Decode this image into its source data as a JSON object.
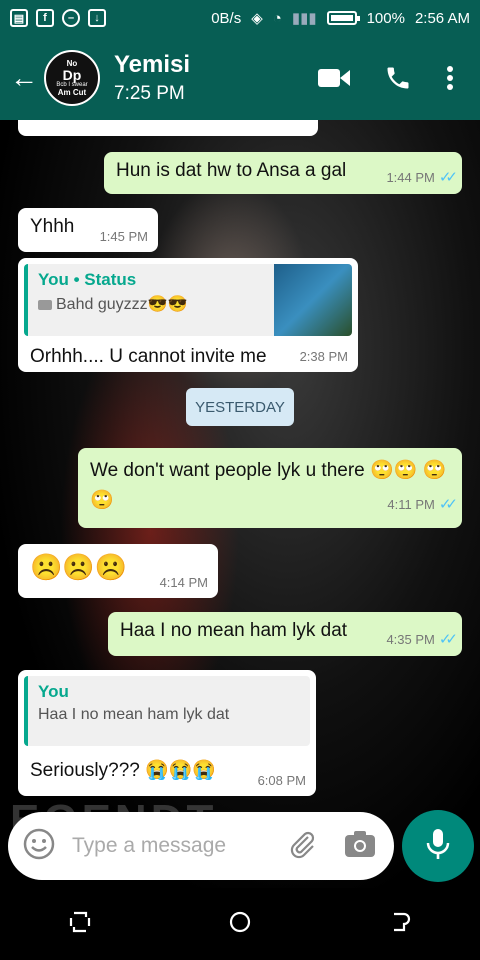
{
  "status_bar": {
    "net_speed": "0B/s",
    "battery_pct": "100%",
    "battery_level": 1.0,
    "time": "2:56 AM"
  },
  "header": {
    "contact_name": "Yemisi",
    "subtitle": "7:25 PM",
    "avatar_lines": [
      "No",
      "Dp",
      "Bcb I swear",
      "Am Cut"
    ]
  },
  "messages": [
    {
      "dir": "out",
      "text": "Hun is dat hw to Ansa a gal",
      "time": "1:44 PM",
      "read": true
    },
    {
      "dir": "in",
      "text": "Yhhh",
      "time": "1:45 PM"
    },
    {
      "dir": "in",
      "quote_author": "You • Status",
      "quote_text": "Bahd guyzzz😎😎",
      "text": "Orhhh.... U cannot invite me",
      "time": "2:38 PM"
    },
    {
      "dir": "out",
      "text": "We don't want people lyk u there 🙄🙄 🙄🙄",
      "time": "4:11 PM",
      "read": true
    },
    {
      "dir": "in",
      "text": "☹️☹️☹️",
      "time": "4:14 PM"
    },
    {
      "dir": "out",
      "text": "Haa I no mean ham lyk dat",
      "time": "4:35 PM",
      "read": true
    },
    {
      "dir": "in",
      "quote_author": "You",
      "quote_text": "Haa I no mean ham lyk dat",
      "text": "Seriously??? 😭😭😭",
      "time": "6:08 PM"
    }
  ],
  "date_divider": "YESTERDAY",
  "composer": {
    "placeholder": "Type a message"
  },
  "colors": {
    "header": "#075e54",
    "outgoing": "#dcf8c6",
    "incoming": "#ffffff",
    "accent": "#00897b",
    "quote_accent": "#06a88e",
    "tick_read": "#4fc3f7"
  },
  "icons": [
    "back-arrow-icon",
    "video-call-icon",
    "voice-call-icon",
    "more-vert-icon",
    "emoji-icon",
    "attach-icon",
    "camera-icon",
    "mic-icon",
    "recent-apps-icon",
    "home-icon",
    "back-nav-icon"
  ]
}
